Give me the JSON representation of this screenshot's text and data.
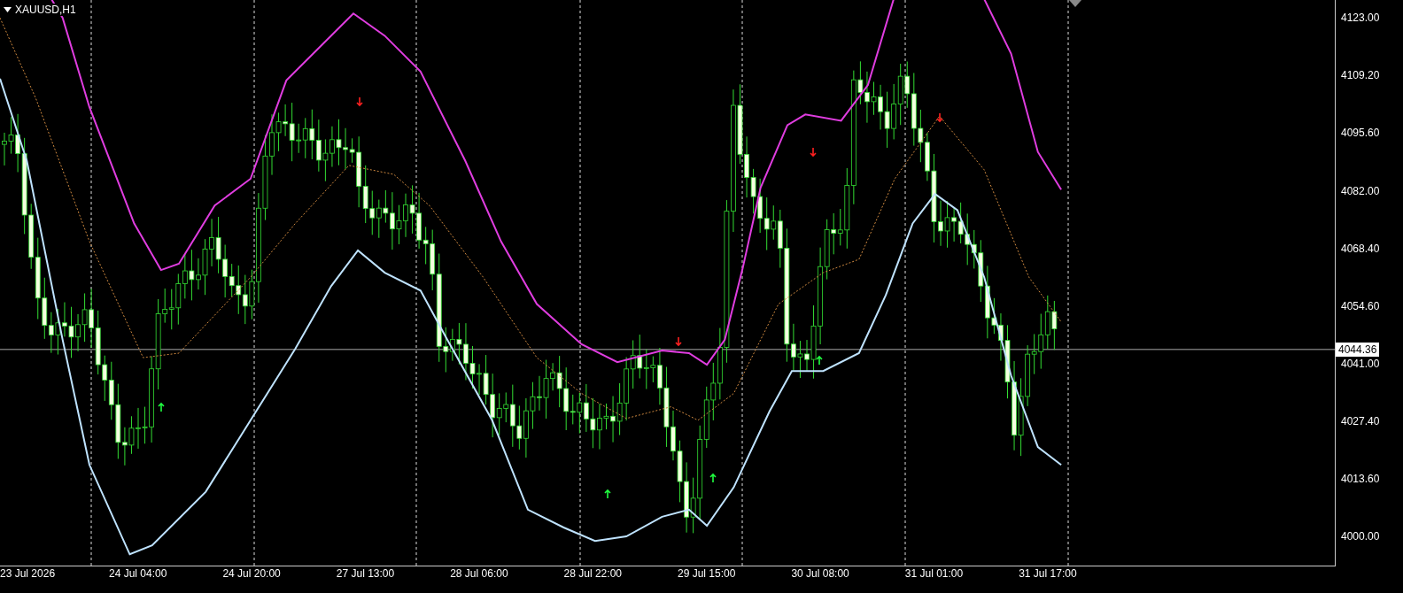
{
  "chart": {
    "symbol": "XAUUSD,H1",
    "price_labels": [
      "4123.00",
      "4109.20",
      "4095.60",
      "4082.00",
      "4068.40",
      "4054.60",
      "4041.00",
      "4027.40",
      "4013.60",
      "4000.00"
    ],
    "current_price": "4044.36",
    "time_labels": [
      "23 Jul 2026",
      "24 Jul 04:00",
      "24 Jul 20:00",
      "27 Jul 13:00",
      "28 Jul 06:00",
      "28 Jul 22:00",
      "29 Jul 15:00",
      "30 Jul 08:00",
      "31 Jul 01:00",
      "31 Jul 17:00"
    ]
  }
}
